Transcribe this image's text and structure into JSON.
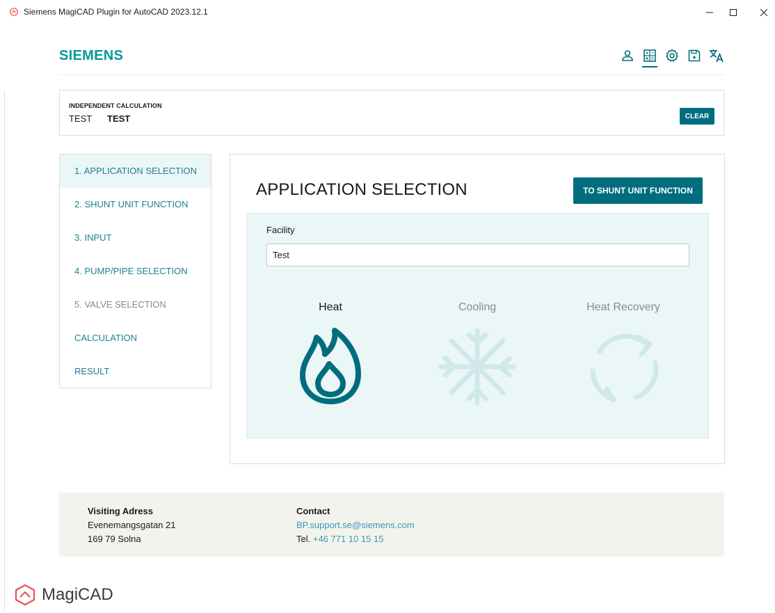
{
  "window": {
    "title": "Siemens MagiCAD Plugin for AutoCAD 2023.12.1",
    "minimize_glyph": "–",
    "maximize_glyph": "☐",
    "close_glyph": "✕"
  },
  "header": {
    "logo": "SIEMENS",
    "icons": [
      "user-icon",
      "calculator-icon",
      "settings-icon",
      "save-icon",
      "translate-icon"
    ],
    "active_icon": "calculator-icon"
  },
  "calculation": {
    "caption": "INDEPENDENT CALCULATION",
    "name_primary": "TEST",
    "name_secondary": "TEST",
    "clear_label": "CLEAR"
  },
  "steps": {
    "items": [
      {
        "label": "1. APPLICATION SELECTION",
        "state": "active"
      },
      {
        "label": "2. SHUNT UNIT FUNCTION",
        "state": "enabled"
      },
      {
        "label": "3. INPUT",
        "state": "enabled"
      },
      {
        "label": "4. PUMP/PIPE SELECTION",
        "state": "enabled"
      },
      {
        "label": "5. VALVE SELECTION",
        "state": "disabled"
      },
      {
        "label": "CALCULATION",
        "state": "enabled"
      },
      {
        "label": "RESULT",
        "state": "enabled"
      }
    ]
  },
  "main": {
    "title": "APPLICATION SELECTION",
    "next_label": "TO SHUNT UNIT FUNCTION",
    "facility_label": "Facility",
    "facility_value": "Test",
    "applications": [
      {
        "label": "Heat",
        "icon": "flame-icon",
        "selected": true
      },
      {
        "label": "Cooling",
        "icon": "snowflake-icon",
        "selected": false
      },
      {
        "label": "Heat Recovery",
        "icon": "recycle-icon",
        "selected": false
      }
    ]
  },
  "footer": {
    "visit_heading": "Visiting Adress",
    "visit_street": "Evenemangsgatan 21",
    "visit_city": "169 79 Solna",
    "contact_heading": "Contact",
    "contact_email": "BP.support.se@siemens.com",
    "contact_phone_prefix": "Tel.",
    "contact_phone": "+46 771 10 15 15"
  },
  "brand": {
    "name": "MagiCAD"
  },
  "colors": {
    "accent": "#006d7e",
    "brand_teal": "#009999",
    "active_bg": "#ebf6f7",
    "inactive_icon": "#cfe9ea",
    "link": "#3b98b8",
    "magicad_red": "#e8544a"
  }
}
